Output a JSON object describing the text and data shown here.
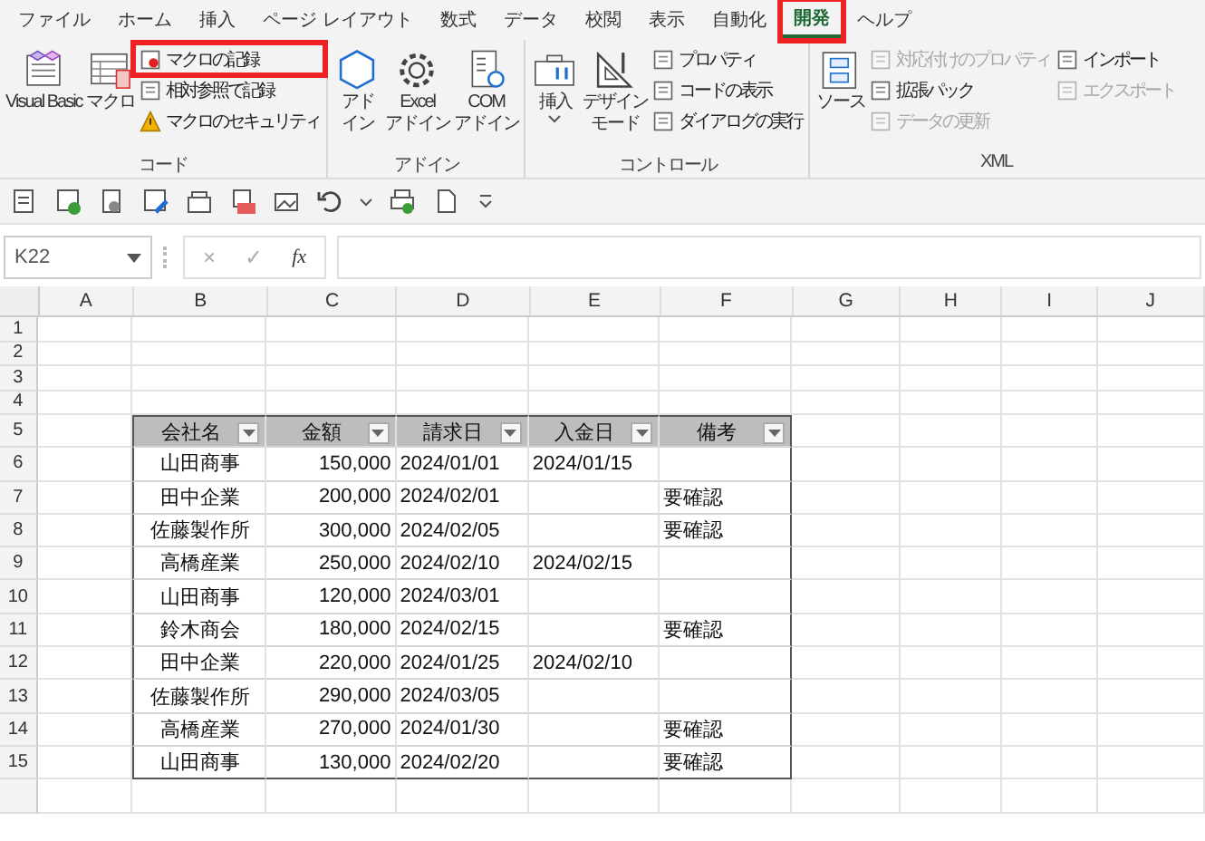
{
  "tabs": [
    {
      "label": "ファイル",
      "selected": false,
      "highlighted": false
    },
    {
      "label": "ホーム",
      "selected": false,
      "highlighted": false
    },
    {
      "label": "挿入",
      "selected": false,
      "highlighted": false
    },
    {
      "label": "ページ レイアウト",
      "selected": false,
      "highlighted": false
    },
    {
      "label": "数式",
      "selected": false,
      "highlighted": false
    },
    {
      "label": "データ",
      "selected": false,
      "highlighted": false
    },
    {
      "label": "校閲",
      "selected": false,
      "highlighted": false
    },
    {
      "label": "表示",
      "selected": false,
      "highlighted": false
    },
    {
      "label": "自動化",
      "selected": false,
      "highlighted": false
    },
    {
      "label": "開発",
      "selected": true,
      "highlighted": true
    },
    {
      "label": "ヘルプ",
      "selected": false,
      "highlighted": false
    }
  ],
  "ribbon": {
    "groups": [
      {
        "label": "コード",
        "blocks": [
          {
            "kind": "large",
            "lines": [
              "Visual Basic"
            ],
            "dropdown": false
          },
          {
            "kind": "large",
            "lines": [
              "マクロ"
            ],
            "dropdown": false
          },
          {
            "kind": "smalls",
            "items": [
              {
                "label": "マクロの記録",
                "disabled": false,
                "highlighted": true
              },
              {
                "label": "相対参照で記録",
                "disabled": false,
                "highlighted": false
              },
              {
                "label": "マクロのセキュリティ",
                "disabled": false,
                "highlighted": false
              }
            ]
          }
        ]
      },
      {
        "label": "アドイン",
        "blocks": [
          {
            "kind": "large",
            "lines": [
              "アド",
              "イン"
            ],
            "dropdown": false
          },
          {
            "kind": "large",
            "lines": [
              "Excel",
              "アドイン"
            ],
            "dropdown": false
          },
          {
            "kind": "large",
            "lines": [
              "COM",
              "アドイン"
            ],
            "dropdown": false
          }
        ]
      },
      {
        "label": "コントロール",
        "blocks": [
          {
            "kind": "large",
            "lines": [
              "挿入"
            ],
            "dropdown": true
          },
          {
            "kind": "large",
            "lines": [
              "デザイン",
              "モード"
            ],
            "dropdown": false
          },
          {
            "kind": "smalls",
            "items": [
              {
                "label": "プロパティ",
                "disabled": false,
                "highlighted": false
              },
              {
                "label": "コードの表示",
                "disabled": false,
                "highlighted": false
              },
              {
                "label": "ダイアログの実行",
                "disabled": false,
                "highlighted": false
              }
            ]
          }
        ]
      },
      {
        "label": "XML",
        "blocks": [
          {
            "kind": "large",
            "lines": [
              "ソース"
            ],
            "dropdown": false
          },
          {
            "kind": "smalls",
            "items": [
              {
                "label": "対応付けのプロパティ",
                "disabled": true,
                "highlighted": false
              },
              {
                "label": "拡張パック",
                "disabled": false,
                "highlighted": false
              },
              {
                "label": "データの更新",
                "disabled": true,
                "highlighted": false
              }
            ]
          },
          {
            "kind": "smalls",
            "items": [
              {
                "label": "インポート",
                "disabled": false,
                "highlighted": false
              },
              {
                "label": "エクスポート",
                "disabled": true,
                "highlighted": false
              }
            ]
          }
        ]
      }
    ]
  },
  "formula_bar": {
    "name_box": "K22",
    "cancel": "×",
    "enter": "✓",
    "function": "fx"
  },
  "sheet": {
    "columns": [
      "A",
      "B",
      "C",
      "D",
      "E",
      "F",
      "G",
      "H",
      "I",
      "J"
    ],
    "row_numbers": [
      "1",
      "2",
      "3",
      "4",
      "5",
      "6",
      "7",
      "8",
      "9",
      "10",
      "11",
      "12",
      "13",
      "14",
      "15"
    ],
    "table": {
      "columns": [
        "会社名",
        "金額",
        "請求日",
        "入金日",
        "備考"
      ],
      "rows": [
        [
          "山田商事",
          "150,000",
          "2024/01/01",
          "2024/01/15",
          ""
        ],
        [
          "田中企業",
          "200,000",
          "2024/02/01",
          "",
          "要確認"
        ],
        [
          "佐藤製作所",
          "300,000",
          "2024/02/05",
          "",
          "要確認"
        ],
        [
          "高橋産業",
          "250,000",
          "2024/02/10",
          "2024/02/15",
          ""
        ],
        [
          "山田商事",
          "120,000",
          "2024/03/01",
          "",
          ""
        ],
        [
          "鈴木商会",
          "180,000",
          "2024/02/15",
          "",
          "要確認"
        ],
        [
          "田中企業",
          "220,000",
          "2024/01/25",
          "2024/02/10",
          ""
        ],
        [
          "佐藤製作所",
          "290,000",
          "2024/03/05",
          "",
          ""
        ],
        [
          "高橋産業",
          "270,000",
          "2024/01/30",
          "",
          "要確認"
        ],
        [
          "山田商事",
          "130,000",
          "2024/02/20",
          "",
          "要確認"
        ]
      ]
    }
  }
}
